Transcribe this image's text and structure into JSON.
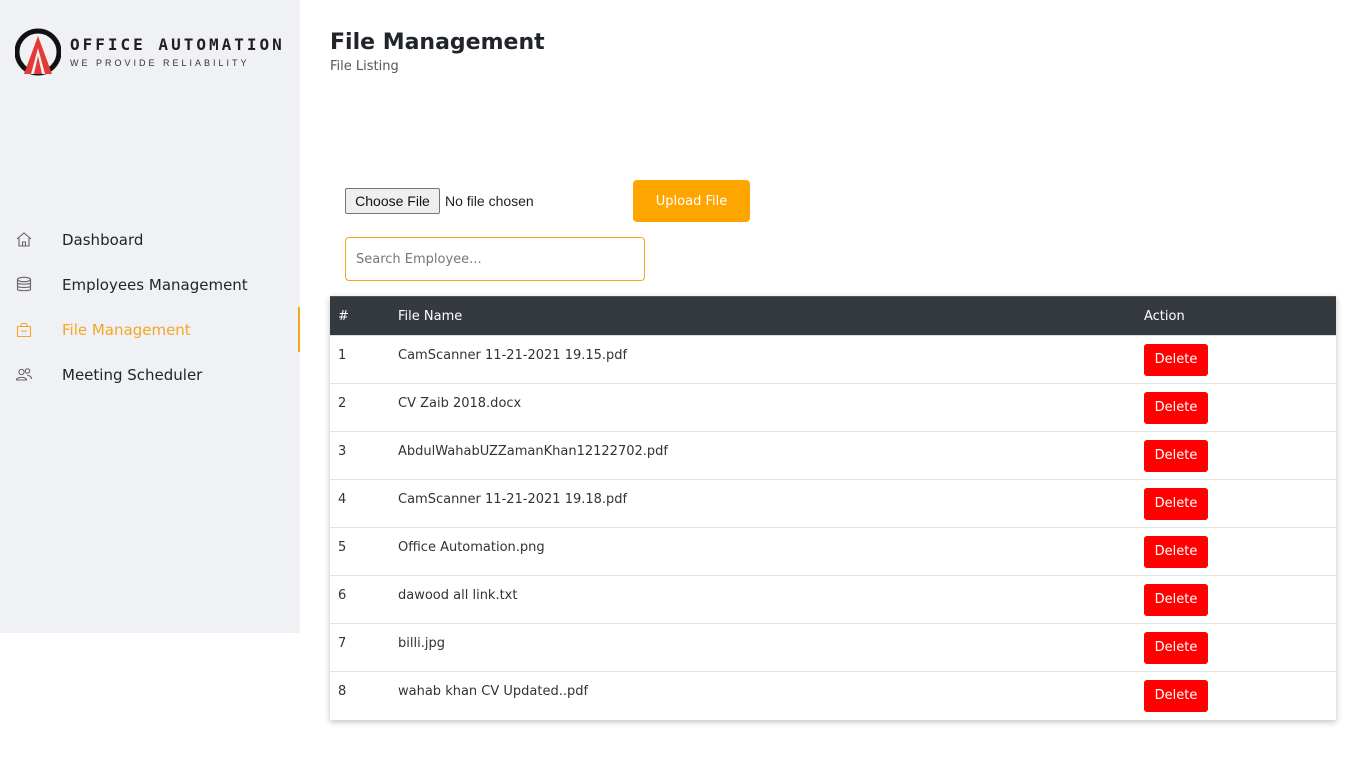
{
  "brand": {
    "title": "OFFICE AUTOMATION",
    "tagline": "WE PROVIDE RELIABILITY",
    "accent": "#f5a623"
  },
  "sidebar": {
    "items": [
      {
        "label": "Dashboard",
        "icon": "home-icon",
        "active": false
      },
      {
        "label": "Employees Management",
        "icon": "database-icon",
        "active": false
      },
      {
        "label": "File Management",
        "icon": "bag-icon",
        "active": true
      },
      {
        "label": "Meeting Scheduler",
        "icon": "users-icon",
        "active": false
      }
    ]
  },
  "header": {
    "title": "File Management",
    "subtitle": "File Listing"
  },
  "upload": {
    "choose_label": "Choose File",
    "status": "No file chosen",
    "upload_label": "Upload File",
    "button_color": "#ffa500"
  },
  "search": {
    "placeholder": "Search Employee..."
  },
  "table": {
    "columns": [
      "#",
      "File Name",
      "Action"
    ],
    "rows": [
      {
        "num": "1",
        "name": "CamScanner 11-21-2021 19.15.pdf",
        "action": "Delete"
      },
      {
        "num": "2",
        "name": "CV Zaib 2018.docx",
        "action": "Delete"
      },
      {
        "num": "3",
        "name": "AbdulWahabUZZamanKhan12122702.pdf",
        "action": "Delete"
      },
      {
        "num": "4",
        "name": "CamScanner 11-21-2021 19.18.pdf",
        "action": "Delete"
      },
      {
        "num": "5",
        "name": "Office Automation.png",
        "action": "Delete"
      },
      {
        "num": "6",
        "name": "dawood all link.txt",
        "action": "Delete"
      },
      {
        "num": "7",
        "name": "billi.jpg",
        "action": "Delete"
      },
      {
        "num": "8",
        "name": "wahab khan CV Updated..pdf",
        "action": "Delete"
      }
    ],
    "header_color": "#343a40",
    "delete_color": "#ff0000"
  }
}
